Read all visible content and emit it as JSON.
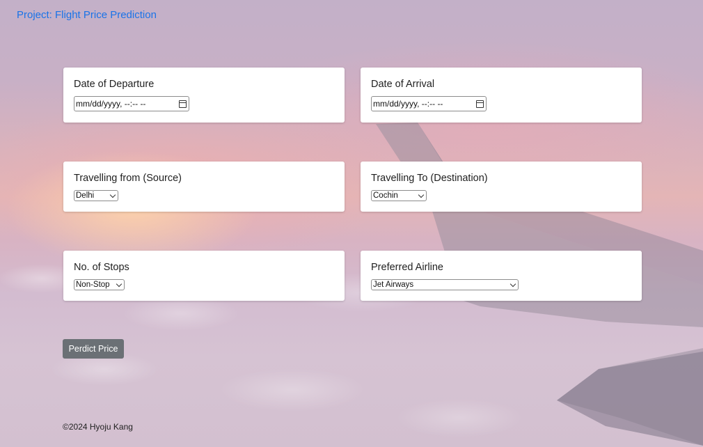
{
  "header": {
    "project_title": "Project: Flight Price Prediction"
  },
  "form": {
    "departure": {
      "label": "Date of Departure",
      "value": "mm/dd/yyyy, --:-- --"
    },
    "arrival": {
      "label": "Date of Arrival",
      "value": "mm/dd/yyyy, --:-- --"
    },
    "source": {
      "label": "Travelling from (Source)",
      "selected": "Delhi"
    },
    "destination": {
      "label": "Travelling To (Destination)",
      "selected": "Cochin"
    },
    "stops": {
      "label": "No. of Stops",
      "selected": "Non-Stop"
    },
    "airline": {
      "label": "Preferred Airline",
      "selected": "Jet Airways"
    },
    "submit_label": "Perdict Price"
  },
  "footer": {
    "text": "©2024 Hyoju Kang"
  },
  "colors": {
    "link": "#1a73e8",
    "button": "#6b7075",
    "card": "#ffffff"
  },
  "icons": {
    "date_picker": "calendar-icon",
    "select": "chevron-down-icon"
  }
}
